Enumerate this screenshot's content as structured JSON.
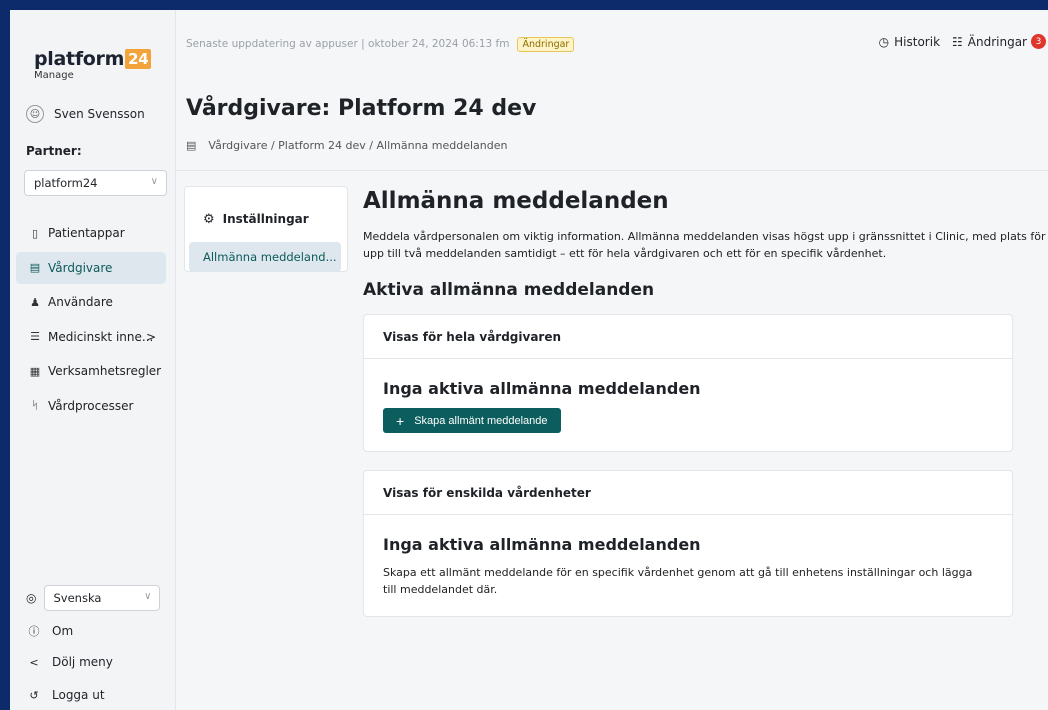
{
  "sidebar": {
    "logo_text": "platform",
    "logo_badge": "24",
    "logo_sub": "Manage",
    "user_name": "Sven Svensson",
    "partner_label": "Partner:",
    "partner_value": "platform24",
    "nav": [
      {
        "label": "Patientappar",
        "icon": "phone-icon"
      },
      {
        "label": "Vårdgivare",
        "icon": "building-icon",
        "active": true
      },
      {
        "label": "Användare",
        "icon": "users-icon"
      },
      {
        "label": "Medicinskt inne...",
        "icon": "list-icon",
        "more": ">"
      },
      {
        "label": "Verksamhetsregler",
        "icon": "rules-icon"
      },
      {
        "label": "Vårdprocesser",
        "icon": "branch-icon"
      }
    ],
    "language": "Svenska",
    "about": "Om",
    "hide_menu": "Dölj meny",
    "logout": "Logga ut"
  },
  "topbar": {
    "update_text": "Senaste uppdatering av appuser | oktober 24, 2024 06:13 fm",
    "changes_badge": "Ändringar",
    "history": "Historik",
    "changes": "Ändringar",
    "changes_count": "3"
  },
  "header": {
    "title": "Vårdgivare: Platform 24 dev",
    "breadcrumb": "Vårdgivare / Platform 24 dev / Allmänna meddelanden"
  },
  "settings": {
    "title": "Inställningar",
    "item": "Allmänna meddeland..."
  },
  "main": {
    "title": "Allmänna meddelanden",
    "description": "Meddela vårdpersonalen om viktig information. Allmänna meddelanden visas högst upp i gränssnittet i Clinic, med plats för upp till två meddelanden samtidigt – ett för hela vårdgivaren och ett för en specifik vårdenhet.",
    "active_title": "Aktiva allmänna meddelanden",
    "card1": {
      "header": "Visas för hela vårdgivaren",
      "empty": "Inga aktiva allmänna meddelanden",
      "button": "Skapa allmänt meddelande"
    },
    "card2": {
      "header": "Visas för enskilda vårdenheter",
      "empty": "Inga aktiva allmänna meddelanden",
      "text": "Skapa ett allmänt meddelande för en specifik vårdenhet genom att gå till enhetens inställningar och lägga till meddelandet där."
    }
  }
}
